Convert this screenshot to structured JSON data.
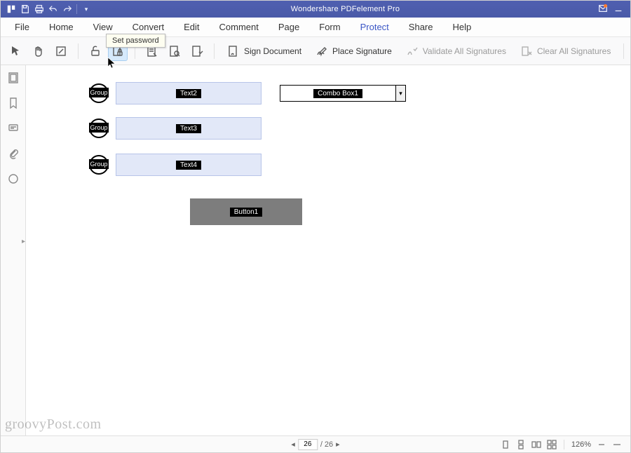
{
  "app": {
    "title": "Wondershare PDFelement Pro"
  },
  "menus": {
    "file": "File",
    "home": "Home",
    "view": "View",
    "convert": "Convert",
    "edit": "Edit",
    "comment": "Comment",
    "page": "Page",
    "form": "Form",
    "protect": "Protect",
    "share": "Share",
    "help": "Help"
  },
  "ribbon": {
    "sign_document": "Sign Document",
    "place_signature": "Place Signature",
    "validate_all": "Validate All Signatures",
    "clear_all": "Clear All Signatures"
  },
  "tooltip": "Set password",
  "form_fields": {
    "group_label": "Group",
    "text2": "Text2",
    "text3": "Text3",
    "text4": "Text4",
    "combo1": "Combo Box1",
    "button1": "Button1"
  },
  "status": {
    "current_page": "26",
    "total_pages": "/ 26",
    "zoom": "126%"
  },
  "watermark": "groovyPost.com",
  "chevrons": {
    "left": "◂",
    "right": "▸",
    "down": "▾"
  }
}
